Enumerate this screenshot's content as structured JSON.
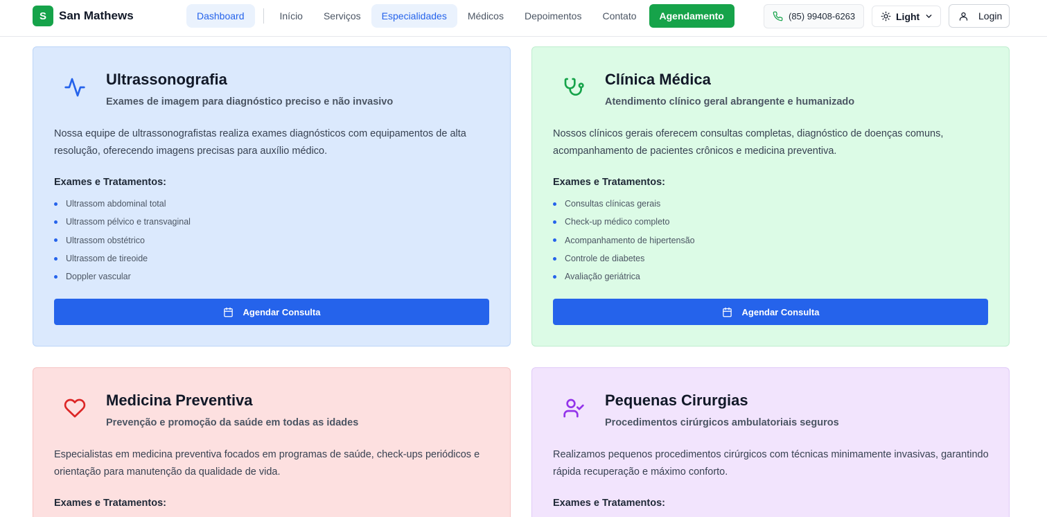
{
  "brand": {
    "letter": "S",
    "name": "San Mathews"
  },
  "nav": {
    "dashboard": "Dashboard",
    "items": [
      "Início",
      "Serviços",
      "Especialidades",
      "Médicos",
      "Depoimentos",
      "Contato"
    ],
    "active": "Especialidades",
    "cta": "Agendamento"
  },
  "header_actions": {
    "phone": "(85) 99408-6263",
    "theme": "Light",
    "login": "Login"
  },
  "cards": [
    {
      "icon": "activity-icon",
      "title": "Ultrassonografia",
      "subtitle": "Exames de imagem para diagnóstico preciso e não invasivo",
      "description": "Nossa equipe de ultrassonografistas realiza exames diagnósticos com equipamentos de alta resolução, oferecendo imagens precisas para auxílio médico.",
      "list_title": "Exames e Tratamentos:",
      "items": [
        "Ultrassom abdominal total",
        "Ultrassom pélvico e transvaginal",
        "Ultrassom obstétrico",
        "Ultrassom de tireoide",
        "Doppler vascular"
      ],
      "button": "Agendar Consulta"
    },
    {
      "icon": "stethoscope-icon",
      "title": "Clínica Médica",
      "subtitle": "Atendimento clínico geral abrangente e humanizado",
      "description": "Nossos clínicos gerais oferecem consultas completas, diagnóstico de doenças comuns, acompanhamento de pacientes crônicos e medicina preventiva.",
      "list_title": "Exames e Tratamentos:",
      "items": [
        "Consultas clínicas gerais",
        "Check-up médico completo",
        "Acompanhamento de hipertensão",
        "Controle de diabetes",
        "Avaliação geriátrica"
      ],
      "button": "Agendar Consulta"
    },
    {
      "icon": "heart-icon",
      "title": "Medicina Preventiva",
      "subtitle": "Prevenção e promoção da saúde em todas as idades",
      "description": "Especialistas em medicina preventiva focados em programas de saúde, check-ups periódicos e orientação para manutenção da qualidade de vida.",
      "list_title": "Exames e Tratamentos:"
    },
    {
      "icon": "user-check-icon",
      "title": "Pequenas Cirurgias",
      "subtitle": "Procedimentos cirúrgicos ambulatoriais seguros",
      "description": "Realizamos pequenos procedimentos cirúrgicos com técnicas minimamente invasivas, garantindo rápida recuperação e máximo conforto.",
      "list_title": "Exames e Tratamentos:"
    }
  ],
  "colors": {
    "brand_green": "#16a34a",
    "primary_blue": "#2563eb",
    "card_blue": "#dbe9fd",
    "card_green": "#dcfbe6",
    "card_red": "#fde0e0",
    "card_purple": "#f2e4fd"
  }
}
